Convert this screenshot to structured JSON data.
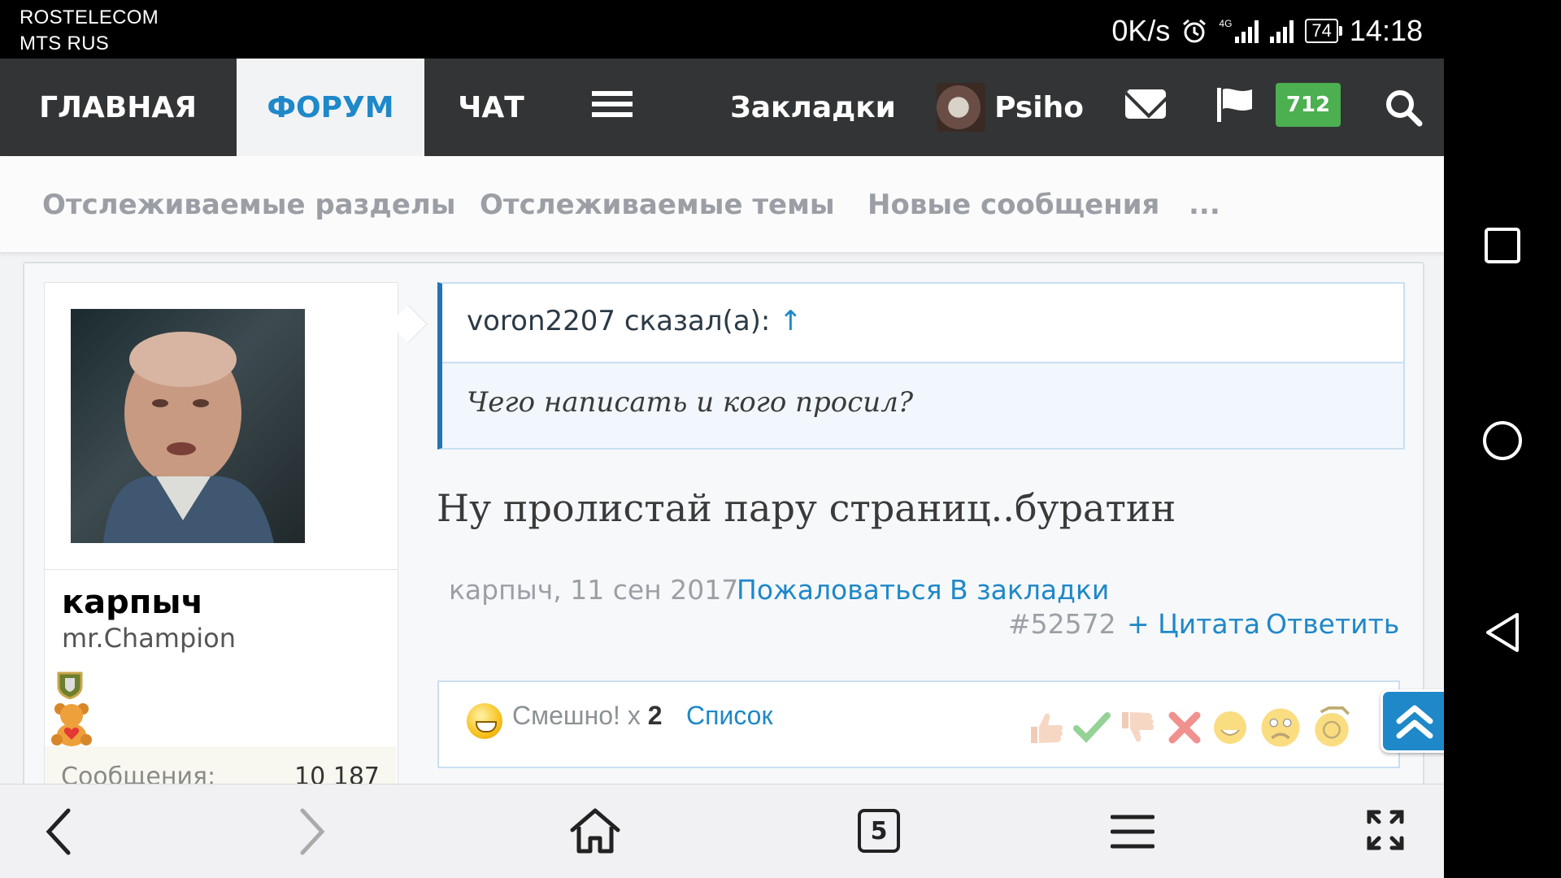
{
  "status_bar": {
    "carrier_1": "ROSTELECOM",
    "carrier_2": "MTS RUS",
    "speed": "0K/s",
    "network": "4G",
    "battery": "74",
    "time": "14:18"
  },
  "main_nav": {
    "tabs": [
      {
        "label": "ГЛАВНАЯ",
        "active": false
      },
      {
        "label": "ФОРУМ",
        "active": true
      },
      {
        "label": "ЧАТ",
        "active": false
      }
    ],
    "bookmarks_label": "Закладки",
    "user_name": "Psiho",
    "notifications_count": "712"
  },
  "sub_nav": {
    "items": [
      "Отслеживаемые разделы",
      "Отслеживаемые темы",
      "Новые сообщения",
      "..."
    ]
  },
  "post": {
    "author": "карпыч",
    "author_title": "mr.Champion",
    "stats": [
      {
        "label": "Сообщения:",
        "value": "10 187"
      }
    ],
    "quote": {
      "author_line": "voron2207 сказал(а):",
      "arrow": "↑",
      "text": "Чего написать и кого просил?"
    },
    "message": "Ну пролистай пару страниц..буратин",
    "meta": {
      "author_date": "карпыч, 11 сен 2017",
      "report": "Пожаловаться",
      "bookmark": "В закладки",
      "post_number": "#52572",
      "quote_action": "+ Цитата",
      "reply": "Ответить"
    },
    "reactions": {
      "summary_label": "Смешно! x",
      "summary_count": "2",
      "list_label": "Список",
      "icons": [
        "thumbs-up-icon",
        "check-icon",
        "thumbs-down-icon",
        "cross-icon",
        "smile-icon",
        "sad-icon",
        "sport-icon"
      ]
    }
  },
  "colors": {
    "accent": "#1e88c9",
    "nav_bg": "#333435",
    "badge": "#4caf50"
  },
  "bottom_bar": {
    "tabs_count": "5"
  }
}
